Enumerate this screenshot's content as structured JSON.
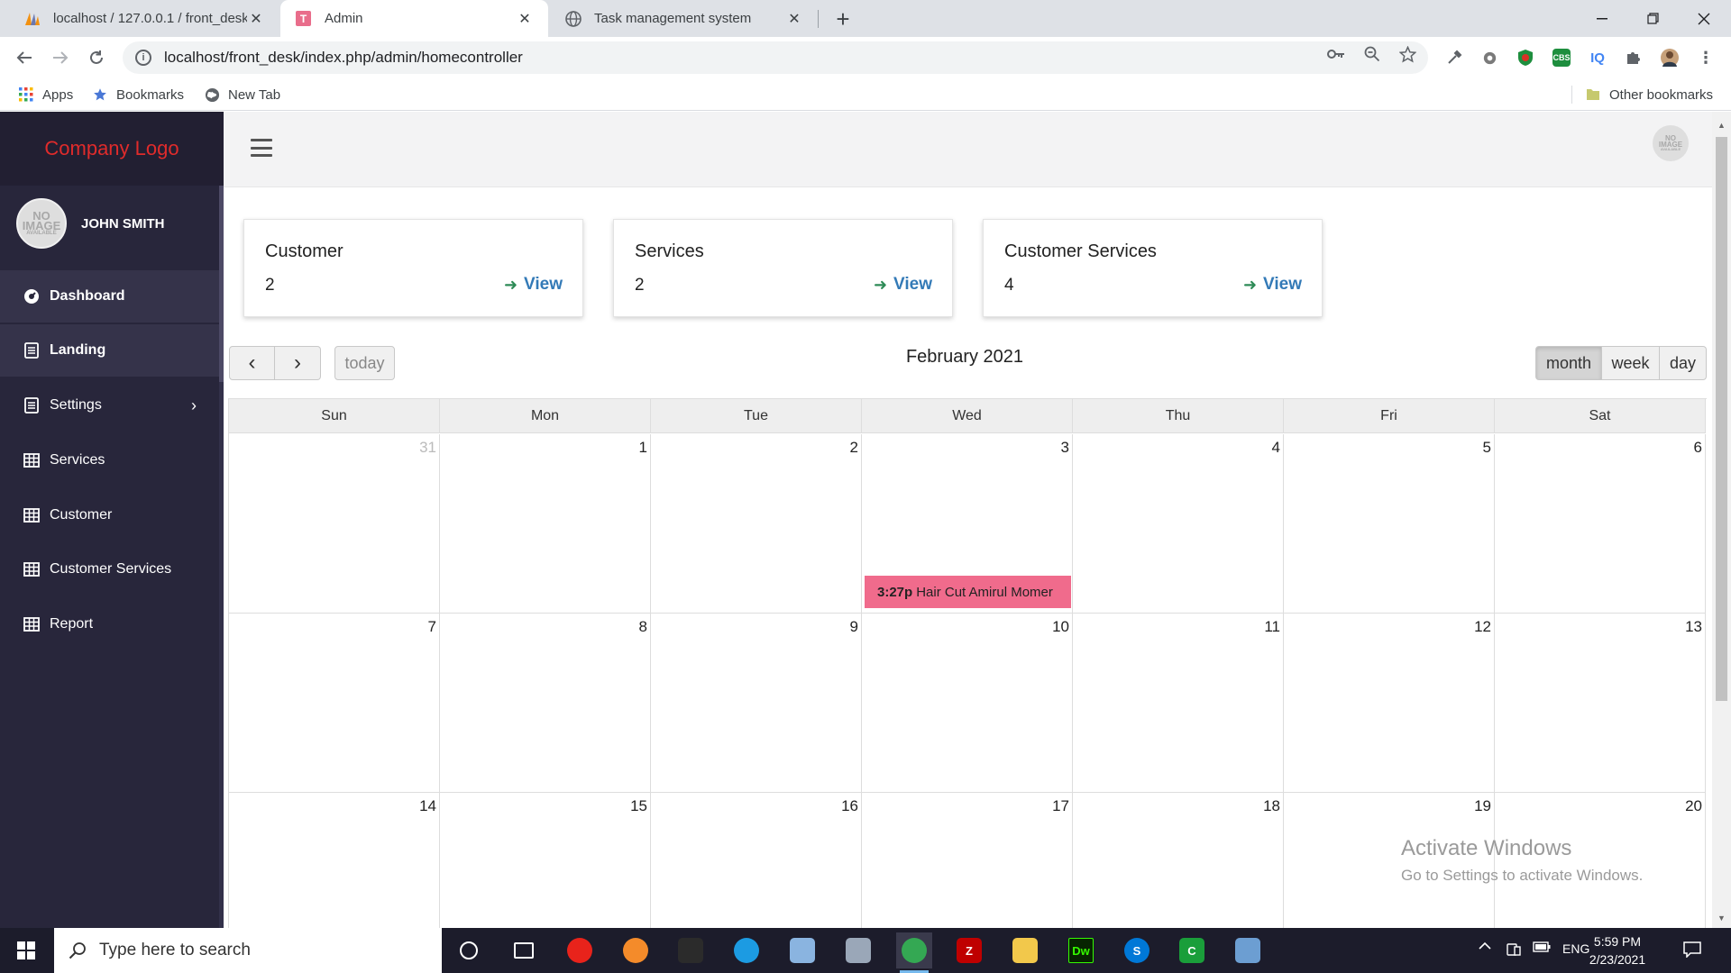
{
  "browser": {
    "tabs": [
      {
        "label": "localhost / 127.0.0.1 / front_desk",
        "favicon": "phpmyadmin-icon"
      },
      {
        "label": "Admin",
        "favicon": "t-letter-icon",
        "active": true
      },
      {
        "label": "Task management system",
        "favicon": "globe-icon"
      }
    ],
    "new_tab": "+",
    "url": "localhost/front_desk/index.php/admin/homecontroller",
    "bookmarks": [
      "Apps",
      "Bookmarks",
      "New Tab"
    ],
    "other_bookmarks": "Other bookmarks",
    "extensions": [
      {
        "label": "",
        "color": "#606468"
      },
      {
        "label": "",
        "color": "#7a7a7a"
      },
      {
        "label": "",
        "color": "#d93025"
      },
      {
        "label": "CBS",
        "color": "#1e8e3e"
      },
      {
        "label": "IQ",
        "color": "#ffffff"
      }
    ]
  },
  "app": {
    "logo": "Company Logo",
    "user_name": "JOHN SMITH",
    "avatar_text": [
      "NO",
      "IMAGE",
      "AVAILABLE"
    ],
    "menu": [
      {
        "label": "Dashboard",
        "icon": "dashboard-icon"
      },
      {
        "label": "Landing",
        "icon": "list-icon"
      },
      {
        "label": "Settings",
        "icon": "list-icon"
      },
      {
        "label": "Services",
        "icon": "grid-icon"
      },
      {
        "label": "Customer",
        "icon": "grid-icon"
      },
      {
        "label": "Customer Services",
        "icon": "grid-icon"
      },
      {
        "label": "Report",
        "icon": "grid-icon"
      }
    ],
    "settings_chevron": "›"
  },
  "dashboard": {
    "cards": [
      {
        "title": "Customer",
        "value": "2",
        "link": "View"
      },
      {
        "title": "Services",
        "value": "2",
        "link": "View"
      },
      {
        "title": "Customer Services",
        "value": "4",
        "link": "View"
      }
    ]
  },
  "calendar": {
    "title": "February 2021",
    "prev": "‹",
    "next": "›",
    "today": "today",
    "views": [
      "month",
      "week",
      "day"
    ],
    "active_view": "month",
    "day_headers": [
      "Sun",
      "Mon",
      "Tue",
      "Wed",
      "Thu",
      "Fri",
      "Sat"
    ],
    "weeks": [
      [
        "31",
        "1",
        "2",
        "3",
        "4",
        "5",
        "6"
      ],
      [
        "7",
        "8",
        "9",
        "10",
        "11",
        "12",
        "13"
      ],
      [
        "14",
        "15",
        "16",
        "17",
        "18",
        "19",
        "20"
      ]
    ],
    "event": {
      "time": "3:27p",
      "title": "Hair Cut Amirul Momer",
      "color": "#f06b8c"
    }
  },
  "watermark": {
    "line1": "Activate Windows",
    "line2": "Go to Settings to activate Windows."
  },
  "taskbar": {
    "search_placeholder": "Type here to search",
    "apps": [
      {
        "name": "cortana-icon",
        "label": "",
        "color": "#ffffff"
      },
      {
        "name": "task-view-icon",
        "label": "",
        "color": "#ffffff"
      },
      {
        "name": "opera-icon",
        "label": "",
        "color": "#e8231b"
      },
      {
        "name": "firefox-icon",
        "label": "",
        "color": "#f48b2a"
      },
      {
        "name": "terminal-icon",
        "label": "",
        "color": "#2b2b2b"
      },
      {
        "name": "edge-icon",
        "label": "",
        "color": "#1c9be2"
      },
      {
        "name": "notepad-icon",
        "label": "",
        "color": "#8ab4e0"
      },
      {
        "name": "scanner-icon",
        "label": "",
        "color": "#9aa7b8"
      },
      {
        "name": "chrome-icon",
        "label": "",
        "color": "#34a853"
      },
      {
        "name": "filezilla-icon",
        "label": "Z",
        "color": "#bf0000"
      },
      {
        "name": "file-explorer-icon",
        "label": "",
        "color": "#f2c84b"
      },
      {
        "name": "dreamweaver-icon",
        "label": "Dw",
        "color": "#072401"
      },
      {
        "name": "skype-icon",
        "label": "S",
        "color": "#0078d7"
      },
      {
        "name": "camtasia-icon",
        "label": "C",
        "color": "#1a9e3a"
      },
      {
        "name": "paint-icon",
        "label": "",
        "color": "#6c9ed2"
      }
    ],
    "language": "ENG",
    "time": "5:59 PM",
    "date": "2/23/2021"
  },
  "colors": {
    "sidebar": "#28263b",
    "logo_text": "#e02b2b",
    "view_link": "#337ab7",
    "view_arrow": "#2e8b57",
    "event": "#f06b8c"
  }
}
